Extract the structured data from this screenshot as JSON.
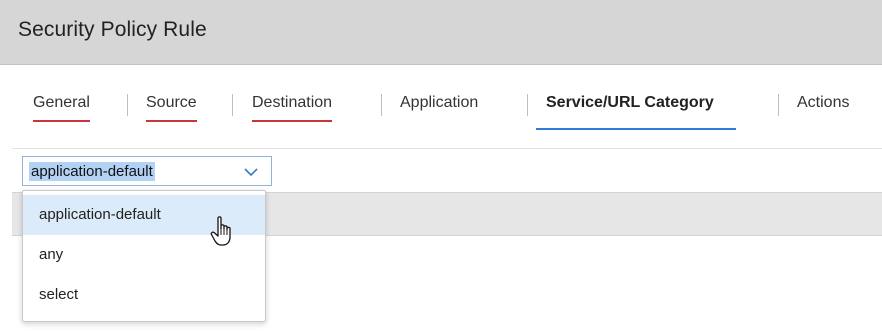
{
  "header": {
    "title": "Security Policy Rule"
  },
  "tabs": [
    {
      "label": "General"
    },
    {
      "label": "Source"
    },
    {
      "label": "Destination"
    },
    {
      "label": "Application"
    },
    {
      "label": "Service/URL Category"
    },
    {
      "label": "Actions"
    }
  ],
  "service_select": {
    "value": "application-default",
    "options": [
      {
        "label": "application-default"
      },
      {
        "label": "any"
      },
      {
        "label": "select"
      }
    ]
  },
  "colors": {
    "header_bg": "#d6d6d6",
    "tab_error_underline": "#c8353a",
    "tab_active_underline": "#2e7bd4",
    "selection_highlight": "#b3d1f5",
    "option_hover": "#dcebf9"
  },
  "icons": {
    "dropdown": "chevron-down-icon",
    "cursor": "hand-pointer-icon"
  }
}
